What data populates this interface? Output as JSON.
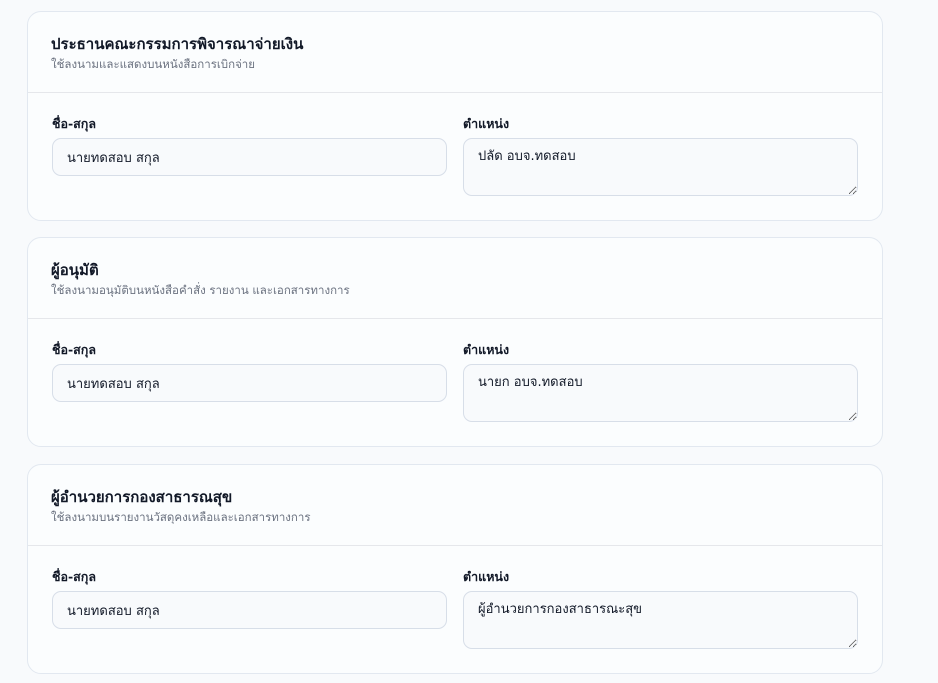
{
  "cards": [
    {
      "title": "ประธานคณะกรรมการพิจารณาจ่ายเงิน",
      "subtitle": "ใช้ลงนามและแสดงบนหนังสือการเบิกจ่าย",
      "name_label": "ชื่อ-สกุล",
      "name_value": "นายทดสอบ สกุล",
      "position_label": "ตำแหน่ง",
      "position_value": "ปลัด อบจ.ทดสอบ"
    },
    {
      "title": "ผู้อนุมัติ",
      "subtitle": "ใช้ลงนามอนุมัติบนหนังสือคำสั่ง รายงาน และเอกสารทางการ",
      "name_label": "ชื่อ-สกุล",
      "name_value": "นายทดสอบ สกุล",
      "position_label": "ตำแหน่ง",
      "position_value": "นายก อบจ.ทดสอบ"
    },
    {
      "title": "ผู้อำนวยการกองสาธารณสุข",
      "subtitle": "ใช้ลงนามบนรายงานวัสดุคงเหลือและเอกสารทางการ",
      "name_label": "ชื่อ-สกุล",
      "name_value": "นายทดสอบ สกุล",
      "position_label": "ตำแหน่ง",
      "position_value": "ผู้อำนวยการกองสาธารณะสุข"
    }
  ]
}
